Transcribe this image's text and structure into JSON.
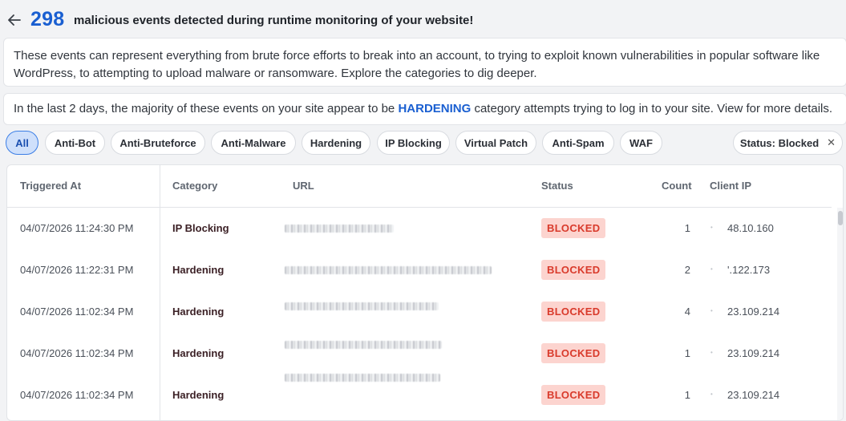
{
  "header": {
    "count": "298",
    "headline": "malicious events detected during runtime monitoring of your website!"
  },
  "intro": {
    "text": "These events can represent everything from brute force efforts to break into an account, to trying to exploit known vulnerabilities in popular software like WordPress, to attempting to upload malware or ransomware. Explore the categories to dig deeper."
  },
  "summary": {
    "prefix": "In the last 2 days, the majority of these events on your site appear to be ",
    "highlight": "HARDENING",
    "suffix": " category attempts trying to log in to your site. View for more details."
  },
  "filters": {
    "chips": [
      {
        "label": "All",
        "active": true
      },
      {
        "label": "Anti-Bot",
        "active": false
      },
      {
        "label": "Anti-Bruteforce",
        "active": false
      },
      {
        "label": "Anti-Malware",
        "active": false
      },
      {
        "label": "Hardening",
        "active": false
      },
      {
        "label": "IP Blocking",
        "active": false
      },
      {
        "label": "Virtual Patch",
        "active": false
      },
      {
        "label": "Anti-Spam",
        "active": false
      },
      {
        "label": "WAF",
        "active": false
      }
    ],
    "status_filter": {
      "label": "Status: Blocked",
      "close_icon": "close-icon"
    }
  },
  "table": {
    "columns": [
      "Triggered At",
      "Category",
      "URL",
      "Status",
      "Count",
      "Client IP"
    ],
    "rows": [
      {
        "triggered_at": "04/07/2026 11:24:30 PM",
        "category": "IP Blocking",
        "status": "BLOCKED",
        "count": "1",
        "client_ip": "48.10.160"
      },
      {
        "triggered_at": "04/07/2026 11:22:31 PM",
        "category": "Hardening",
        "status": "BLOCKED",
        "count": "2",
        "client_ip": "'.122.173"
      },
      {
        "triggered_at": "04/07/2026 11:02:34 PM",
        "category": "Hardening",
        "status": "BLOCKED",
        "count": "4",
        "client_ip": "23.109.214"
      },
      {
        "triggered_at": "04/07/2026 11:02:34 PM",
        "category": "Hardening",
        "status": "BLOCKED",
        "count": "1",
        "client_ip": "23.109.214"
      },
      {
        "triggered_at": "04/07/2026 11:02:34 PM",
        "category": "Hardening",
        "status": "BLOCKED",
        "count": "1",
        "client_ip": "23.109.214"
      }
    ]
  },
  "colors": {
    "accent": "#1a5fd1",
    "badge_bg": "#fcd4cf",
    "badge_text": "#d93a2b",
    "chip_active_bg": "#cfe0fb"
  }
}
